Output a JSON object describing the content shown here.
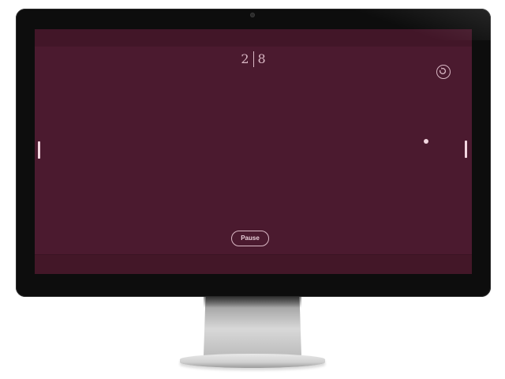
{
  "game": {
    "score": {
      "left": "2",
      "right": "8"
    },
    "pause_label": "Pause",
    "restart_icon": "restart-icon"
  },
  "colors": {
    "field": "#4b1a2f",
    "field_bars": "#421628",
    "foreground": "#d9b7c4",
    "paddle": "#f2d6e0",
    "bezel": "#0d0d0d"
  }
}
